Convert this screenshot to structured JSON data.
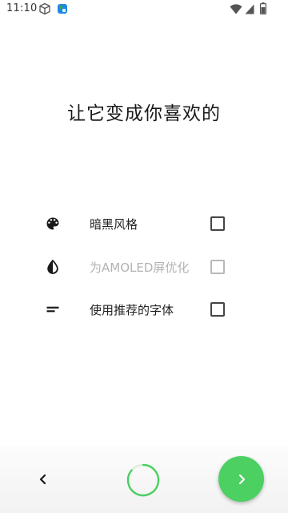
{
  "status_bar": {
    "time": "11:10",
    "icons": [
      "cube-icon",
      "app-badge-icon",
      "wifi-icon",
      "signal-icon",
      "battery-icon"
    ]
  },
  "title": "让它变成你喜欢的",
  "options": [
    {
      "icon": "palette-icon",
      "label": "暗黑风格",
      "checked": false,
      "enabled": true
    },
    {
      "icon": "contrast-drop-icon",
      "label": "为AMOLED屏优化",
      "checked": false,
      "enabled": false
    },
    {
      "icon": "short-text-icon",
      "label": "使用推荐的字体",
      "checked": false,
      "enabled": true
    }
  ],
  "navigation": {
    "back_icon": "chevron-left-icon",
    "next_icon": "chevron-right-icon",
    "progress_icon": "progress-ring-icon"
  },
  "colors": {
    "accent": "#4cd062",
    "text": "#222222",
    "disabled_text": "#b3b3b3"
  }
}
